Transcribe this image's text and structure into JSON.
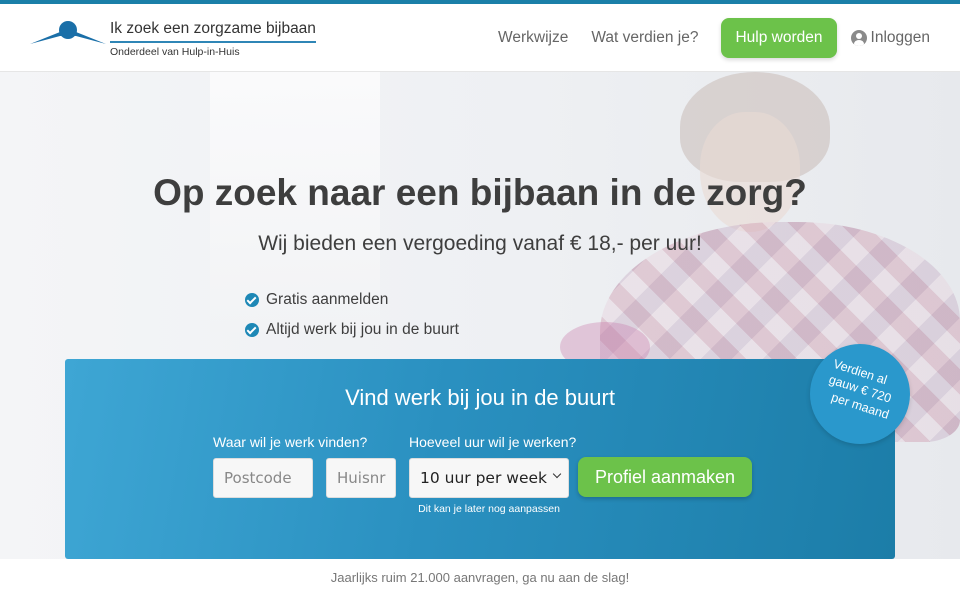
{
  "header": {
    "logo_title": "Ik zoek een zorgzame bijbaan",
    "logo_subtitle": "Onderdeel van Hulp-in-Huis",
    "nav": {
      "how_it_works": "Werkwijze",
      "earnings": "Wat verdien je?",
      "become_helper": "Hulp worden",
      "login": "Inloggen"
    }
  },
  "hero": {
    "title": "Op zoek naar een bijbaan in de zorg?",
    "subtitle": "Wij bieden een vergoeding vanaf € 18,- per uur!",
    "bullets": [
      "Gratis aanmelden",
      "Altijd werk bij jou in de buurt"
    ]
  },
  "search": {
    "title": "Vind werk bij jou in de buurt",
    "where_label": "Waar wil je werk vinden?",
    "hours_label": "Hoeveel uur wil je werken?",
    "postcode_placeholder": "Postcode",
    "housenumber_placeholder": "Huisnr",
    "hours_value": "10 uur per week",
    "hint": "Dit kan je later nog aanpassen",
    "cta": "Profiel aanmaken"
  },
  "badge": {
    "line1": "Verdien al",
    "line2": "gauw € 720",
    "line3": "per maand"
  },
  "footnote": "Jaarlijks ruim 21.000 aanvragen, ga nu aan de slag!",
  "colors": {
    "brand_blue": "#1e88b6",
    "cta_green": "#6cc24a"
  }
}
